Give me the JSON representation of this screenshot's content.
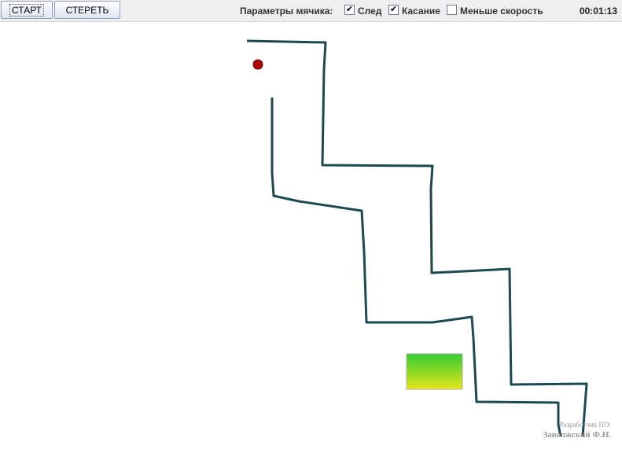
{
  "toolbar": {
    "start_label": "СТАРТ",
    "clear_label": "СТЕРЕТЬ",
    "ball_params_label": "Параметры мячика:",
    "options": [
      {
        "label": "След",
        "checked": true
      },
      {
        "label": "Касание",
        "checked": true
      },
      {
        "label": "Меньше скорость",
        "checked": false
      }
    ],
    "timer": "00:01:13"
  },
  "scene": {
    "wall_color": "#1d4a4f",
    "ball_color": "#b30000",
    "target_gradient": [
      "#33cc33",
      "#e6e619"
    ]
  },
  "credit": {
    "line1": "Разработчик ПО:",
    "line2": "Заволжский Ф.Н."
  }
}
